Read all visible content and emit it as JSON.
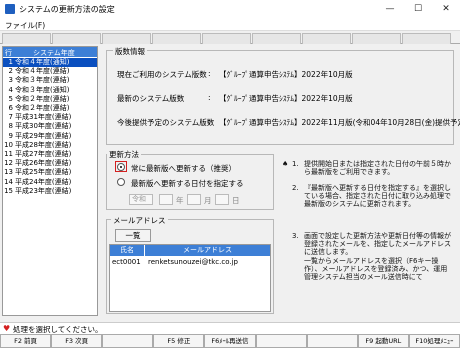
{
  "window": {
    "title": "システムの更新方法の設定",
    "min": "—",
    "max": "☐",
    "close": "✕"
  },
  "menu": {
    "file": "ファイル(F)"
  },
  "list": {
    "col_num": "行",
    "col_title": "システム年度",
    "rows": [
      {
        "n": "1",
        "label": "令和４年度(通知)",
        "selected": true
      },
      {
        "n": "2",
        "label": "令和４年度(連結)"
      },
      {
        "n": "3",
        "label": "令和３年度(連結)"
      },
      {
        "n": "4",
        "label": "令和３年度(通知)"
      },
      {
        "n": "5",
        "label": "令和２年度(連結)"
      },
      {
        "n": "6",
        "label": "令和２年度(連結)"
      },
      {
        "n": "7",
        "label": "平成31年度(連結)"
      },
      {
        "n": "8",
        "label": "平成30年度(連結)"
      },
      {
        "n": "9",
        "label": "平成29年度(連結)"
      },
      {
        "n": "10",
        "label": "平成28年度(連結)"
      },
      {
        "n": "11",
        "label": "平成27年度(連結)"
      },
      {
        "n": "12",
        "label": "平成26年度(連結)"
      },
      {
        "n": "13",
        "label": "平成25年度(連結)"
      },
      {
        "n": "14",
        "label": "平成24年度(連結)"
      },
      {
        "n": "15",
        "label": "平成23年度(連結)"
      }
    ]
  },
  "version_info": {
    "group_label": "版数情報",
    "rows": [
      {
        "label": "現在ご利用のシステム版数",
        "value": "【ｸﾞﾙｰﾌﾟ通算申告ｼｽﾃﾑ】2022年10月版"
      },
      {
        "label": "最新のシステム版数",
        "value": "【ｸﾞﾙｰﾌﾟ通算申告ｼｽﾃﾑ】2022年10月版"
      },
      {
        "label": "今後提供予定のシステム版数",
        "value": "【ｸﾞﾙｰﾌﾟ通算申告ｼｽﾃﾑ】2022年11月版(令和04年10月28日(金)提供予定)"
      }
    ],
    "colon": ":"
  },
  "update_method": {
    "group_label": "更新方法",
    "option_always": "常に最新版へ更新する（推奨）",
    "option_date": "最新版へ更新する日付を指定する",
    "era": "令和",
    "year_unit": "年",
    "month_unit": "月",
    "day_unit": "日"
  },
  "mail": {
    "group_label": "メールアドレス",
    "list_button": "一覧",
    "col_name": "氏名",
    "col_address": "メールアドレス",
    "rows": [
      {
        "name": "ect0001",
        "address": "renketsunouzei@tkc.co.jp"
      }
    ]
  },
  "notes": [
    {
      "mark": "1.",
      "text": "提供開始日または指定された日付の午前５時から最新版をご利用できます。"
    },
    {
      "mark": "2.",
      "text": "『最新版へ更新する日付を指定する』を選択している場合、指定された日付に取り込み処理で最新版のシステムに更新されます。"
    },
    {
      "mark": "3.",
      "text": "画面で設定した更新方法や更新日付等の情報が登録されたメールを、指定したメールアドレスに送信します。\n一覧からメールアドレスを選択（F6キー操作）、メールアドレスを登録済み、かつ、運用管理システム担当のメール送信時にて"
    }
  ],
  "status": {
    "message": "処理を選択してください。"
  },
  "fkeys": [
    {
      "label": "F2 前頁"
    },
    {
      "label": "F3 次頁"
    },
    {
      "label": ""
    },
    {
      "label": "F5 修正"
    },
    {
      "label": "F6ﾒｰﾙ再送信"
    },
    {
      "label": ""
    },
    {
      "label": ""
    },
    {
      "label": "F9 起動URL"
    },
    {
      "label": "F10処理ﾒﾆｭｰ"
    }
  ]
}
